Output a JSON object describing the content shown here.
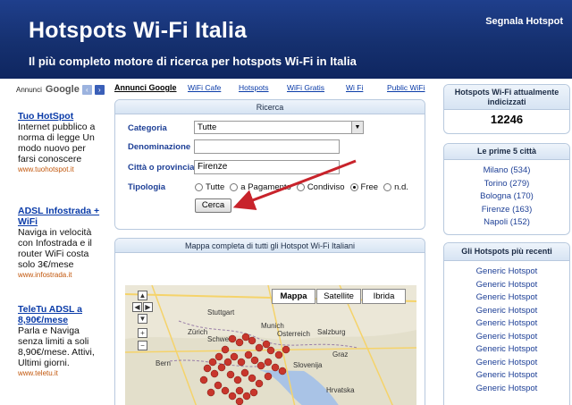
{
  "header": {
    "title": "Hotspots Wi-Fi Italia",
    "subtitle": "Il più completo motore di ricerca per hotspots Wi-Fi in Italia",
    "signal_link": "Segnala Hotspot"
  },
  "ads": {
    "label": "Annunci",
    "google": "Google",
    "prev_arrow": "‹",
    "next_arrow": "›",
    "items": [
      {
        "title": "Tuo HotSpot",
        "text": "Internet pubblico a norma di legge Un modo nuovo per farsi conoscere",
        "url": "www.tuohotspot.it"
      },
      {
        "title": "ADSL Infostrada + WiFi",
        "text": "Naviga in velocità con Infostrada e il router WiFi costa solo 3€/mese",
        "url": "www.infostrada.it"
      },
      {
        "title": "TeleTu ADSL a 8,90€/mese",
        "text": "Parla e Naviga senza limiti a soli 8,90€/mese. Attivi, Ultimi giorni.",
        "url": "www.teletu.it"
      }
    ]
  },
  "linkbar": {
    "items": [
      "Annunci Google",
      "WiFi Cafe",
      "Hotspots",
      "WiFi Gratis",
      "Wi Fi",
      "Public WiFi"
    ]
  },
  "search": {
    "title": "Ricerca",
    "categoria_label": "Categoria",
    "categoria_value": "Tutte",
    "denominazione_label": "Denominazione",
    "denominazione_value": "",
    "citta_label": "Città o provincia",
    "citta_value": "Firenze",
    "tipologia_label": "Tipologia",
    "tipologia_options": [
      "Tutte",
      "a Pagamento",
      "Condiviso",
      "Free",
      "n.d."
    ],
    "tipologia_selected": "Free",
    "submit_label": "Cerca"
  },
  "map": {
    "title": "Mappa completa di tutti gli Hotspot Wi-Fi Italiani",
    "types": [
      "Mappa",
      "Satellite",
      "Ibrida"
    ],
    "active_type": "Mappa",
    "places": [
      "Stuttgart",
      "Munich",
      "Salzburg",
      "Schweiz",
      "Osterreich",
      "Slovenija",
      "Hrvatska",
      "Zürich",
      "Graz",
      "Bern"
    ]
  },
  "stats": {
    "title": "Hotspots Wi-Fi attualmente indicizzati",
    "count": "12246"
  },
  "top_cities": {
    "title": "Le prime 5 città",
    "items": [
      "Milano (534)",
      "Torino (279)",
      "Bologna (170)",
      "Firenze (163)",
      "Napoli (152)"
    ]
  },
  "recent": {
    "title": "Gli Hotspots più recenti",
    "items": [
      "Generic Hotspot",
      "Generic Hotspot",
      "Generic Hotspot",
      "Generic Hotspot",
      "Generic Hotspot",
      "Generic Hotspot",
      "Generic Hotspot",
      "Generic Hotspot",
      "Generic Hotspot",
      "Generic Hotspot"
    ]
  },
  "colors": {
    "header_bg": "#15306f",
    "link": "#0a3ba8",
    "label": "#1d3f96",
    "ad_url": "#c2570c",
    "annotation_arrow": "#c8232b"
  }
}
